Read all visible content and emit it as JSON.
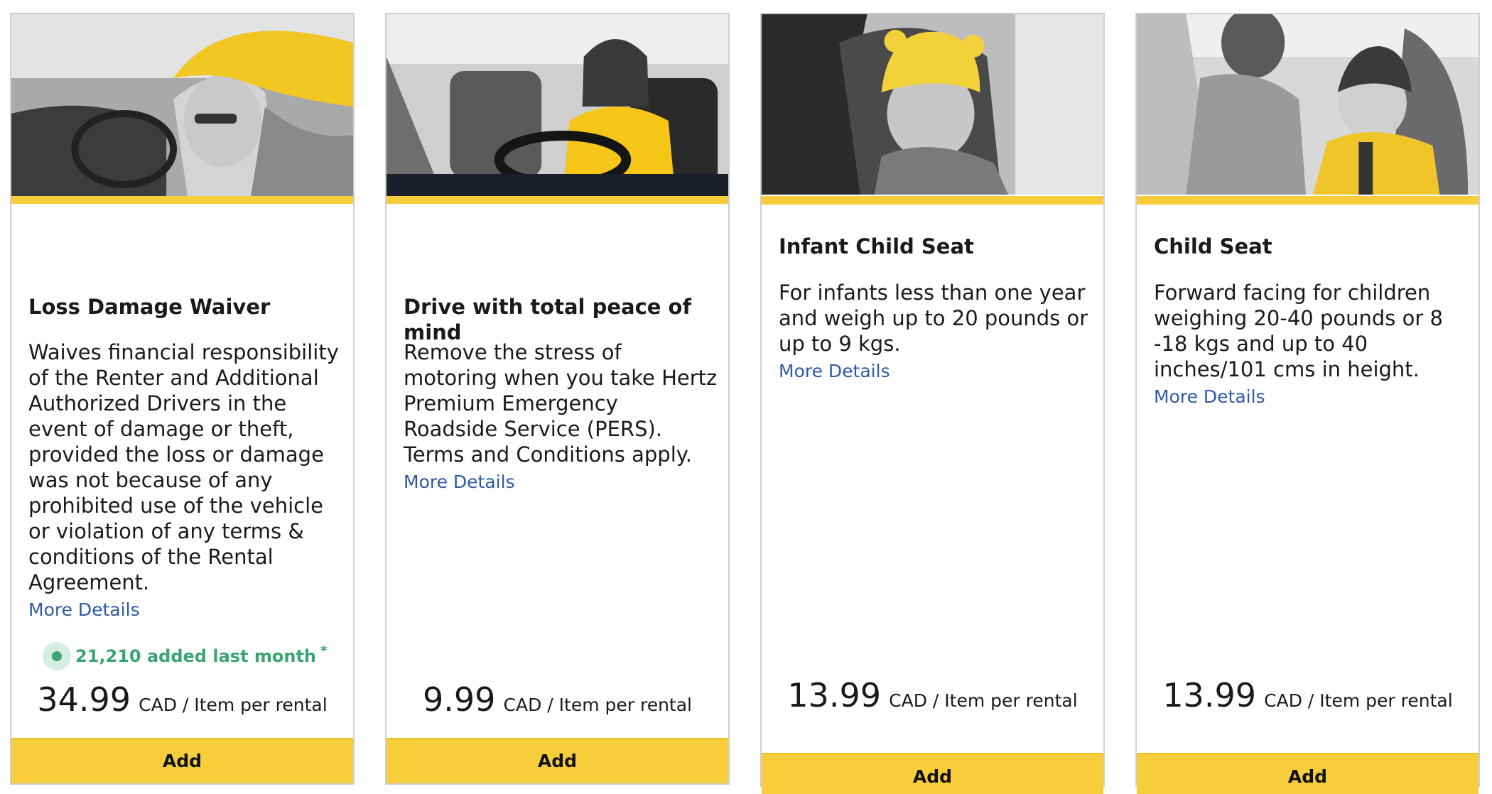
{
  "cards": [
    {
      "title": "Loss Damage Waiver",
      "description": "Waives financial responsibility of the Renter and Additional Authorized Drivers in the event of damage or theft, provided the loss or damage was not because of any prohibited use of the vehicle or violation of any terms & conditions of the Rental Agreement.",
      "more_link": "More Details",
      "social_proof": "21,210 added last month",
      "social_mark": "*",
      "price": "34.99",
      "price_unit": "CAD / Item per rental",
      "add_label": "Add"
    },
    {
      "title": "Drive with total peace of mind",
      "description": "Remove the stress of motoring when you take Hertz Premium Emergency Roadside Service (PERS). Terms and Conditions apply.",
      "more_link": "More Details",
      "price": "9.99",
      "price_unit": "CAD / Item per rental",
      "add_label": "Add"
    },
    {
      "title": "Infant Child Seat",
      "description": "For infants less than one year and weigh up to 20 pounds or up to 9 kgs.",
      "more_link": "More Details",
      "price": "13.99",
      "price_unit": "CAD / Item per rental",
      "add_label": "Add"
    },
    {
      "title": "Child Seat",
      "description": "Forward facing for children weighing 20-40 pounds or 8 -18 kgs and up to 40 inches/101 cms in height.",
      "more_link": "More Details",
      "price": "13.99",
      "price_unit": "CAD / Item per rental",
      "add_label": "Add"
    }
  ],
  "colors": {
    "accent_yellow": "#f7cd3b",
    "link_blue": "#2f5aa8",
    "social_green": "#3aa574"
  }
}
